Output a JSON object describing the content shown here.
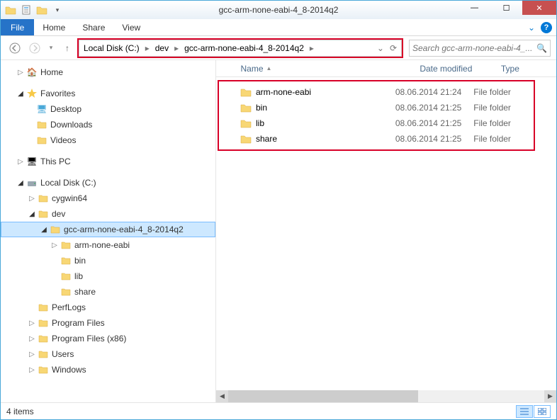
{
  "window": {
    "title": "gcc-arm-none-eabi-4_8-2014q2"
  },
  "ribbon": {
    "file": "File",
    "tabs": [
      "Home",
      "Share",
      "View"
    ]
  },
  "breadcrumb": [
    "Local Disk (C:)",
    "dev",
    "gcc-arm-none-eabi-4_8-2014q2"
  ],
  "search": {
    "placeholder": "Search gcc-arm-none-eabi-4_..."
  },
  "columns": {
    "name": "Name",
    "date": "Date modified",
    "type": "Type"
  },
  "files": [
    {
      "name": "arm-none-eabi",
      "date": "08.06.2014 21:24",
      "type": "File folder"
    },
    {
      "name": "bin",
      "date": "08.06.2014 21:25",
      "type": "File folder"
    },
    {
      "name": "lib",
      "date": "08.06.2014 21:25",
      "type": "File folder"
    },
    {
      "name": "share",
      "date": "08.06.2014 21:25",
      "type": "File folder"
    }
  ],
  "tree": {
    "home": "Home",
    "favorites": "Favorites",
    "fav_items": [
      "Desktop",
      "Downloads",
      "Videos"
    ],
    "thispc": "This PC",
    "localdisk": "Local Disk (C:)",
    "c_items": {
      "cygwin": "cygwin64",
      "dev": "dev",
      "gcc": "gcc-arm-none-eabi-4_8-2014q2",
      "gcc_sub": [
        "arm-none-eabi",
        "bin",
        "lib",
        "share"
      ],
      "perflogs": "PerfLogs",
      "pf": "Program Files",
      "pf86": "Program Files (x86)",
      "users": "Users",
      "windows": "Windows"
    }
  },
  "status": {
    "text": "4 items"
  }
}
